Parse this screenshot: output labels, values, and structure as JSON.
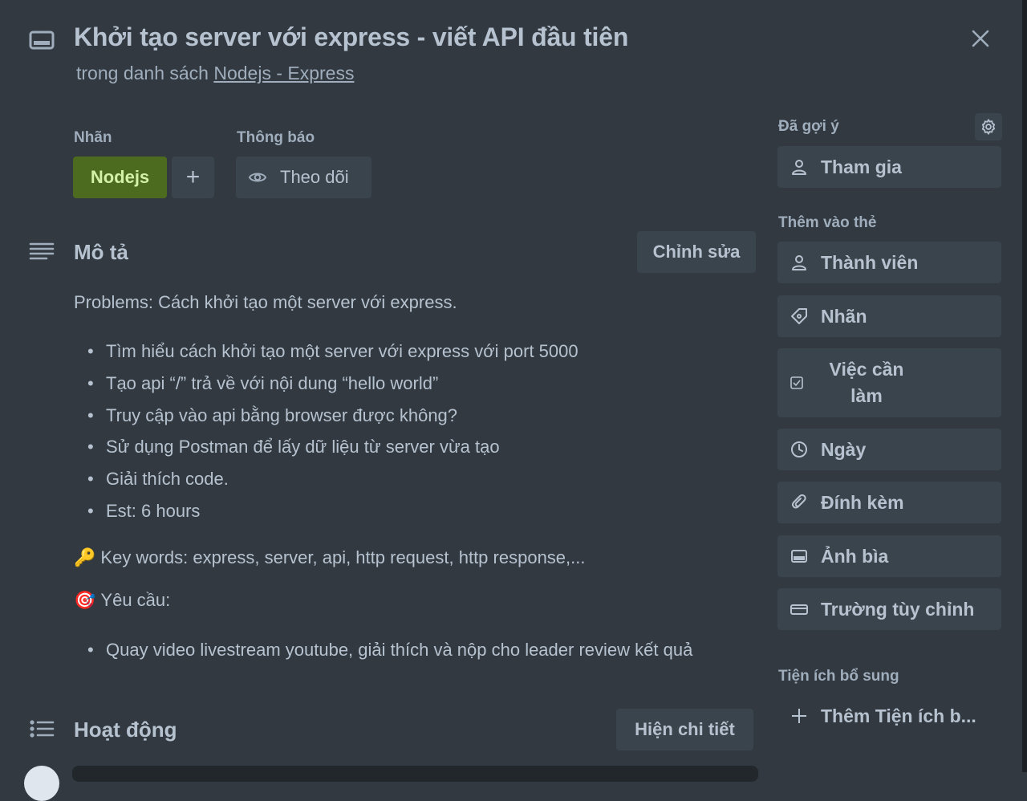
{
  "card": {
    "title": "Khởi tạo server với express - viết API đầu tiên",
    "subtitle_prefix": "trong danh sách ",
    "list_name": "Nodejs - Express"
  },
  "labels": {
    "section_label": "Nhãn",
    "chip": "Nodejs",
    "chip_color": "#4c6b1f",
    "add_symbol": "+"
  },
  "notifications": {
    "section_label": "Thông báo",
    "watch_label": "Theo dõi"
  },
  "description": {
    "title": "Mô tả",
    "edit_label": "Chỉnh sửa",
    "intro": "Problems: Cách khởi tạo một server với express.",
    "bullets": [
      "Tìm hiểu cách khởi tạo một server với express với port 5000",
      "Tạo api “/” trả về với nội dung “hello world”",
      "Truy cập vào api bằng browser được không?",
      "Sử dụng Postman để lấy dữ liệu từ server vừa tạo",
      "Giải thích code.",
      "Est: 6 hours"
    ],
    "keywords_emoji": "🔑",
    "keywords": "Key words: express, server, api, http request, http response,...",
    "requirement_emoji": "🎯",
    "requirement_title": "Yêu cầu:",
    "requirement_bullets": [
      "Quay video livestream youtube, giải thích và nộp cho leader review kết quả"
    ]
  },
  "activity": {
    "title": "Hoạt động",
    "show_details_label": "Hiện chi tiết"
  },
  "sidebar": {
    "suggested_label": "Đã gợi ý",
    "join_label": "Tham gia",
    "add_to_card_label": "Thêm vào thẻ",
    "items": [
      {
        "label": "Thành viên",
        "icon": "person-icon"
      },
      {
        "label": "Nhãn",
        "icon": "tag-icon"
      },
      {
        "label": "Việc cần làm",
        "icon": "checklist-icon"
      },
      {
        "label": "Ngày",
        "icon": "clock-icon"
      },
      {
        "label": "Đính kèm",
        "icon": "paperclip-icon"
      },
      {
        "label": "Ảnh bìa",
        "icon": "cover-icon"
      },
      {
        "label": "Trường tùy chỉnh",
        "icon": "custom-field-icon"
      }
    ],
    "powerups_label": "Tiện ích bổ sung",
    "add_powerup_label": "Thêm Tiện ích b..."
  }
}
